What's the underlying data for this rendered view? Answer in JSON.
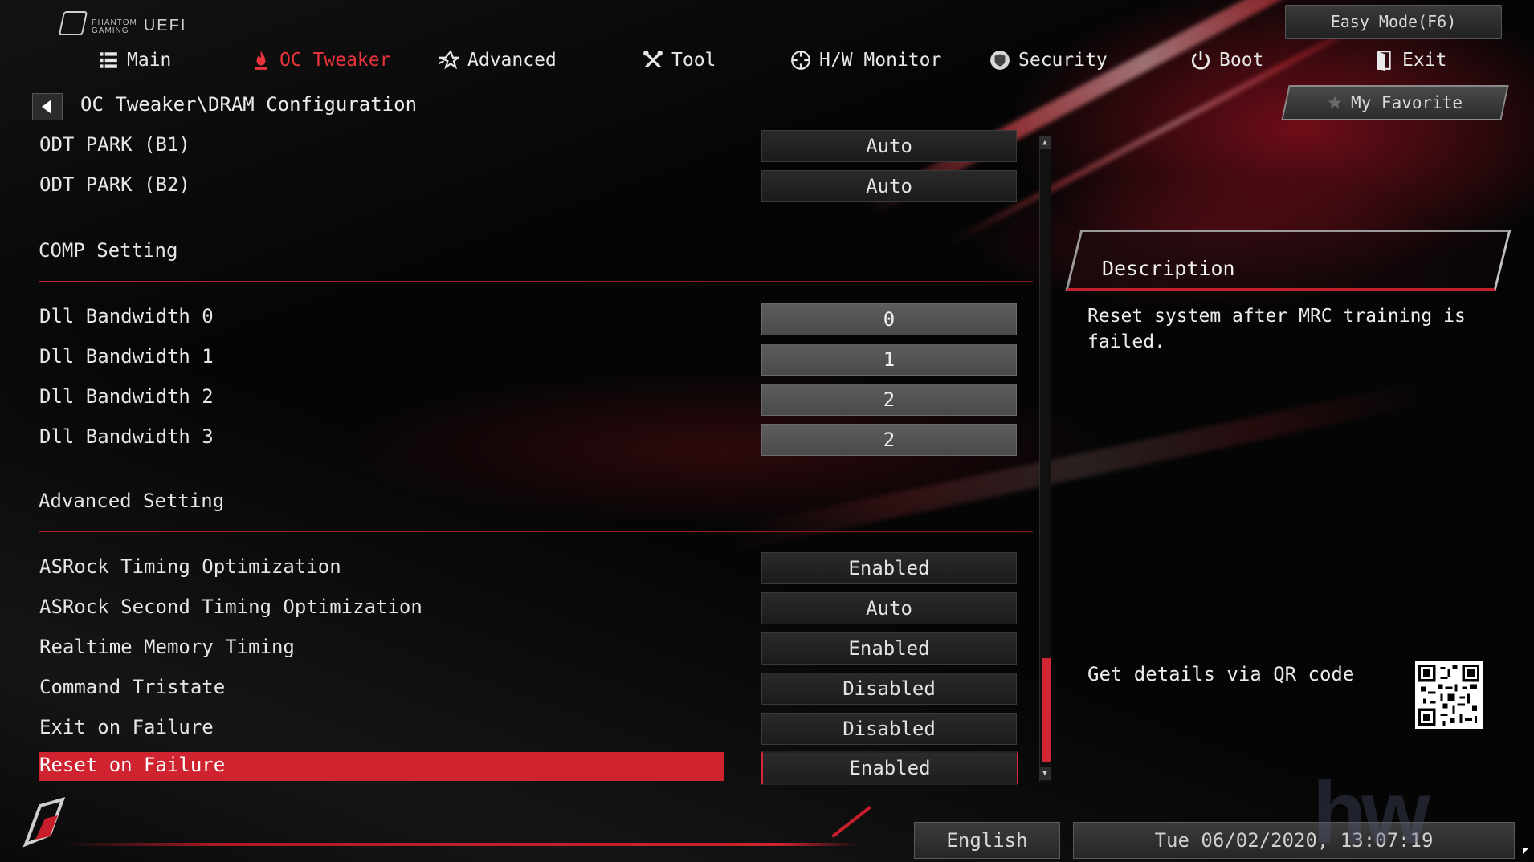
{
  "brand": {
    "line1": "PHANTOM",
    "line2": "GAMING",
    "product": "UEFI"
  },
  "easy_mode_label": "Easy Mode(F6)",
  "nav": {
    "main": "Main",
    "oc_tweaker": "OC Tweaker",
    "advanced": "Advanced",
    "tool": "Tool",
    "hw_monitor": "H/W Monitor",
    "security": "Security",
    "boot": "Boot",
    "exit": "Exit"
  },
  "breadcrumb": "OC Tweaker\\DRAM Configuration",
  "my_favorite": "My Favorite",
  "settings": {
    "odt_park_b1": {
      "label": "ODT PARK (B1)",
      "value": "Auto"
    },
    "odt_park_b2": {
      "label": "ODT PARK (B2)",
      "value": "Auto"
    },
    "comp_setting": "COMP Setting",
    "dll_bw_0": {
      "label": "Dll Bandwidth 0",
      "value": "0"
    },
    "dll_bw_1": {
      "label": "Dll Bandwidth 1",
      "value": "1"
    },
    "dll_bw_2": {
      "label": "Dll Bandwidth 2",
      "value": "2"
    },
    "dll_bw_3": {
      "label": "Dll Bandwidth 3",
      "value": "2"
    },
    "advanced_setting": "Advanced Setting",
    "asrock_timing_opt": {
      "label": "ASRock Timing Optimization",
      "value": "Enabled"
    },
    "asrock_second_timing_opt": {
      "label": "ASRock Second Timing Optimization",
      "value": "Auto"
    },
    "realtime_memory_timing": {
      "label": "Realtime Memory Timing",
      "value": "Enabled"
    },
    "command_tristate": {
      "label": "Command Tristate",
      "value": "Disabled"
    },
    "exit_on_failure": {
      "label": "Exit on Failure",
      "value": "Disabled"
    },
    "reset_on_failure": {
      "label": "Reset on Failure",
      "value": "Enabled"
    }
  },
  "description": {
    "title": "Description",
    "text": "Reset system after MRC training is failed."
  },
  "qr_label": "Get details via QR code",
  "footer": {
    "language": "English",
    "datetime": "Tue 06/02/2020, 13:07:19"
  },
  "colors": {
    "accent_red": "#d22634",
    "background": "#050505",
    "value_box": "#222222",
    "text": "#e6e6e6"
  },
  "icons": {
    "main": "list-icon",
    "oc_tweaker": "flame-icon",
    "advanced": "star-icon",
    "tool": "tools-icon",
    "hw_monitor": "crosshair-icon",
    "security": "shield-icon",
    "boot": "power-icon",
    "exit": "exit-door-icon"
  }
}
